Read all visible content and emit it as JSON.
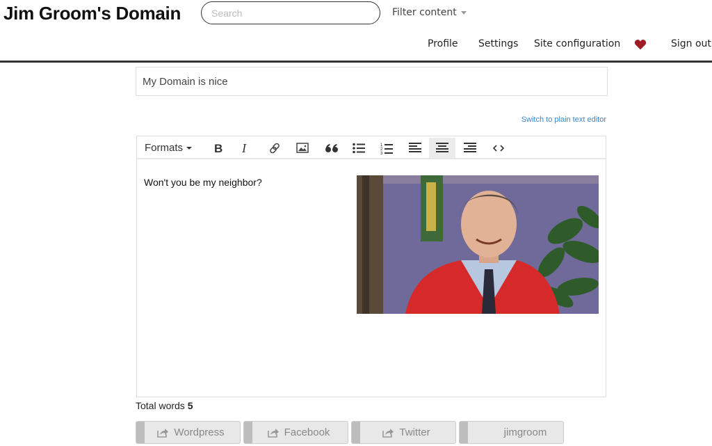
{
  "header": {
    "site_title": "Jim Groom's Domain",
    "search_placeholder": "Search",
    "search_value": "",
    "filter_label": "Filter content",
    "nav": [
      "Profile",
      "Settings",
      "Site configuration",
      "Sign out"
    ],
    "heart_color": "#a01c24"
  },
  "post": {
    "title_value": "My Domain is nice",
    "switch_editor_label": "Switch to plain text editor",
    "toolbar": {
      "formats_label": "Formats",
      "buttons": [
        "bold-icon",
        "italic-icon",
        "link-icon",
        "image-icon",
        "blockquote-icon",
        "bullet-list-icon",
        "numbered-list-icon",
        "align-left-icon",
        "align-center-icon",
        "align-right-icon",
        "code-icon"
      ],
      "active": "align-center-icon"
    },
    "body_text": "Won't you be my neighbor?",
    "image_alt": "Photo of a smiling man in a red cardigan and tie in front of a purple wall with a plant"
  },
  "footer": {
    "word_count_label": "Total words",
    "word_count_value": "5",
    "share_buttons": [
      "Wordpress",
      "Facebook",
      "Twitter",
      "jimgroom"
    ]
  }
}
